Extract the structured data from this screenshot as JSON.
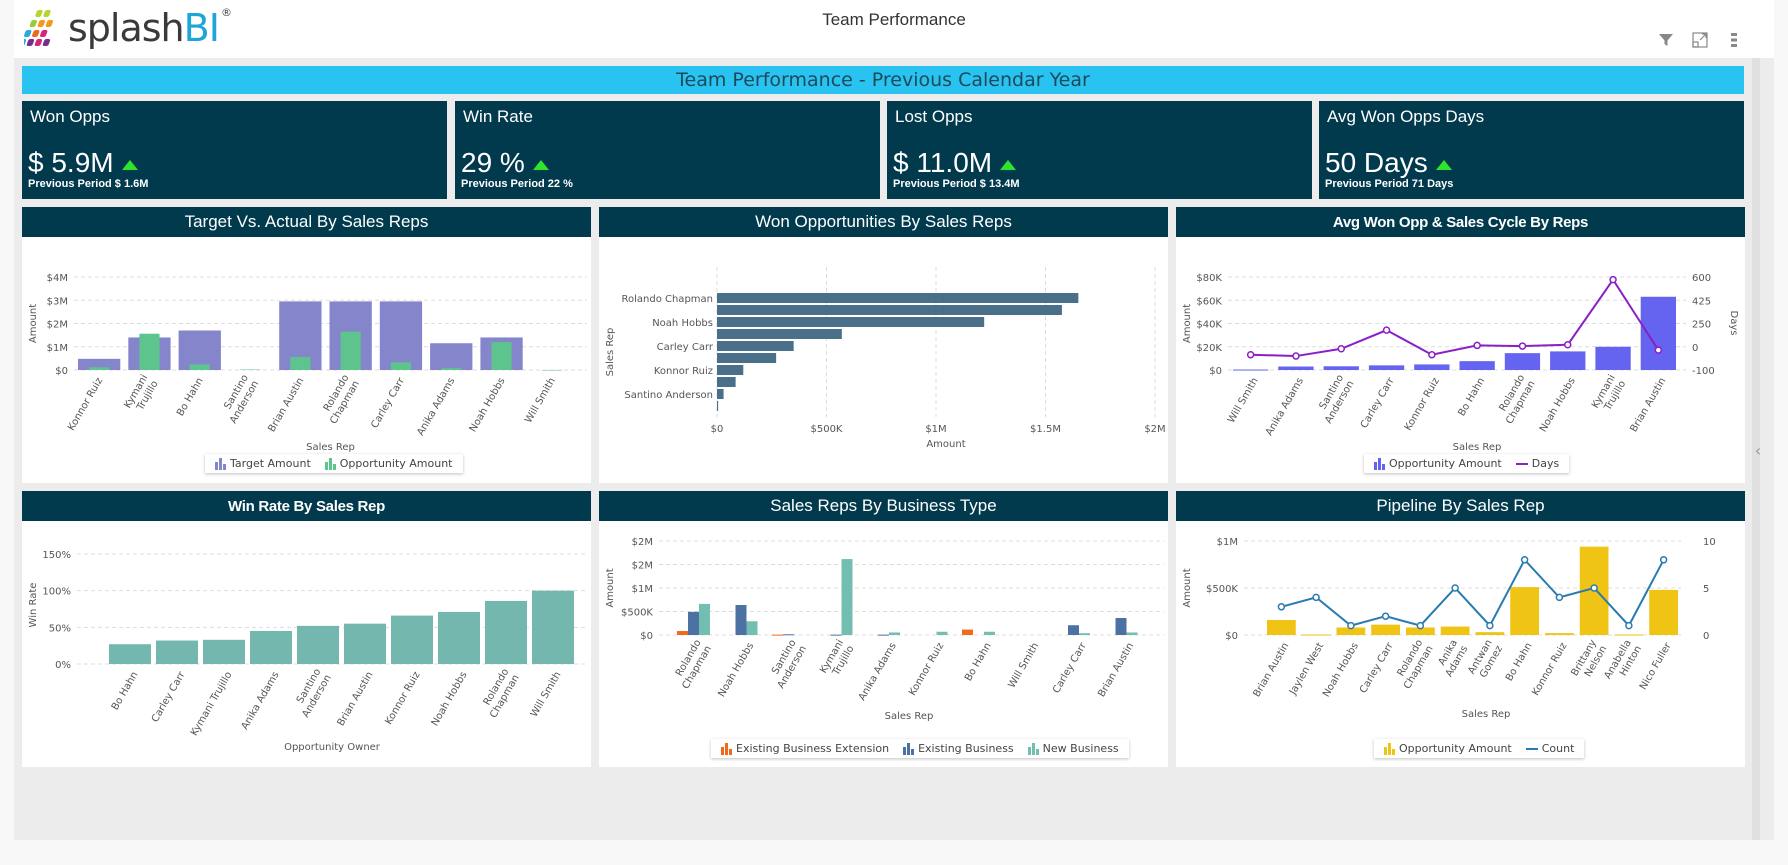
{
  "app": {
    "logo_text_main": "splash",
    "logo_text_accent": "BI",
    "logo_reg": "®",
    "page_title": "Team Performance",
    "icons": [
      "filter-icon",
      "expand-icon",
      "more-vertical-icon"
    ],
    "banner": "Team Performance - Previous Calendar Year",
    "collapse_glyph": "‹"
  },
  "kpis": [
    {
      "label": "Won Opps",
      "value": "$ 5.9M",
      "previous": "Previous Period $ 1.6M",
      "trend": "up"
    },
    {
      "label": "Win Rate",
      "value": "29 %",
      "previous": "Previous Period 22 %",
      "trend": "up"
    },
    {
      "label": "Lost Opps",
      "value": "$ 11.0M",
      "previous": "Previous Period $ 13.4M",
      "trend": "up"
    },
    {
      "label": "Avg Won Opps Days",
      "value": "50 Days",
      "previous": "Previous Period 71 Days",
      "trend": "up"
    }
  ],
  "colors": {
    "target": "#8585cc",
    "opp_green": "#5cc48c",
    "won_bar": "#4a6f88",
    "avg_bar": "#6464f0",
    "days_line": "#8a1fc6",
    "winrate": "#74b7ae",
    "ext": "#f06a1c",
    "existing": "#4c72a4",
    "newbiz": "#72bfb2",
    "pipeline_bar": "#f0c414",
    "count_line": "#2a7bb0"
  },
  "chart_data": [
    {
      "id": "target-vs-actual",
      "title": "Target Vs. Actual By Sales Reps",
      "type": "bar",
      "xlabel": "Sales Rep",
      "ylabel": "Amount",
      "ylim": [
        0,
        4000000
      ],
      "yticks": [
        "$0",
        "$1M",
        "$2M",
        "$3M",
        "$4M"
      ],
      "categories": [
        "Konnor Ruiz",
        "Kymani Trujillo",
        "Bo Hahn",
        "Santino Anderson",
        "Brian Austin",
        "Rolando Chapman",
        "Carley Carr",
        "Anika Adams",
        "Noah Hobbs",
        "Will Smith"
      ],
      "category_lines": [
        [
          "Konnor Ruiz"
        ],
        [
          "Kymani",
          "Trujillo"
        ],
        [
          "Bo Hahn"
        ],
        [
          "Santino",
          "Anderson"
        ],
        [
          "Brian Austin"
        ],
        [
          "Rolando",
          "Chapman"
        ],
        [
          "Carley Carr"
        ],
        [
          "Anika Adams"
        ],
        [
          "Noah Hobbs"
        ],
        [
          "Will Smith"
        ]
      ],
      "series": [
        {
          "name": "Target Amount",
          "values": [
            480000,
            1400000,
            1700000,
            0,
            2950000,
            2950000,
            2950000,
            1150000,
            1400000,
            0
          ]
        },
        {
          "name": "Opportunity Amount",
          "values": [
            120000,
            1560000,
            240000,
            20000,
            560000,
            1650000,
            330000,
            80000,
            1200000,
            0
          ]
        }
      ],
      "legend": [
        "Target Amount",
        "Opportunity Amount"
      ],
      "legend_position": "bottom"
    },
    {
      "id": "won-opps",
      "title": "Won Opportunities By Sales Reps",
      "type": "bar",
      "orientation": "horizontal",
      "xlabel": "Amount",
      "ylabel": "Sales Rep",
      "xlim": [
        0,
        2000000
      ],
      "xticks": [
        "$0",
        "$500K",
        "$1M",
        "$1.5M",
        "$2M"
      ],
      "categories": [
        "Rolando Chapman",
        "",
        "Noah Hobbs",
        "",
        "Carley Carr",
        "",
        "Konnor Ruiz",
        "",
        "Santino Anderson",
        ""
      ],
      "values": [
        1650000,
        1575000,
        1220000,
        570000,
        350000,
        270000,
        120000,
        85000,
        30000,
        5000
      ]
    },
    {
      "id": "avg-won-opp",
      "title": "Avg Won Opp & Sales Cycle By Reps",
      "type": "bar",
      "xlabel": "Sales Rep",
      "ylabel": "Amount",
      "y2label": "Days",
      "ylim": [
        0,
        80000
      ],
      "yticks": [
        "$0",
        "$20K",
        "$40K",
        "$60K",
        "$80K"
      ],
      "y2lim": [
        -100,
        600
      ],
      "y2ticks": [
        "-100",
        "0",
        "250",
        "425",
        "600"
      ],
      "categories": [
        "Will Smith",
        "Anika Adams",
        "Santino Anderson",
        "Carley Carr",
        "Konnor Ruiz",
        "Bo Hahn",
        "Rolando Chapman",
        "Noah Hobbs",
        "Kymani Trujillo",
        "Brian Austin"
      ],
      "category_lines": [
        [
          "Will Smith"
        ],
        [
          "Anika Adams"
        ],
        [
          "Santino",
          "Anderson"
        ],
        [
          "Carley Carr"
        ],
        [
          "Konnor Ruiz"
        ],
        [
          "Bo Hahn"
        ],
        [
          "Rolando",
          "Chapman"
        ],
        [
          "Noah Hobbs"
        ],
        [
          "Kymani",
          "Trujillo"
        ],
        [
          "Brian Austin"
        ]
      ],
      "series": [
        {
          "name": "Opportunity Amount",
          "type": "bar",
          "values": [
            400,
            3000,
            3200,
            4000,
            4800,
            7600,
            14500,
            16000,
            20000,
            63000
          ]
        },
        {
          "name": "Days",
          "type": "line",
          "axis": "right",
          "values": [
            15,
            5,
            60,
            200,
            15,
            85,
            80,
            90,
            580,
            50
          ]
        }
      ],
      "legend": [
        "Opportunity Amount",
        "Days"
      ],
      "legend_position": "bottom"
    },
    {
      "id": "win-rate",
      "title": "Win Rate By Sales Rep",
      "type": "bar",
      "xlabel": "Opportunity Owner",
      "ylabel": "Win Rate",
      "ylim": [
        0,
        150
      ],
      "yticks": [
        "0%",
        "50%",
        "100%",
        "150%"
      ],
      "categories": [
        "Bo Hahn",
        "Carley Carr",
        "Kymani Trujillo",
        "Anika Adams",
        "Santino Anderson",
        "Brian Austin",
        "Konnor Ruiz",
        "Noah Hobbs",
        "Rolando Chapman",
        "Will Smith"
      ],
      "category_lines": [
        [
          "Bo Hahn"
        ],
        [
          "Carley Carr"
        ],
        [
          "Kymani Trujillo"
        ],
        [
          "Anika Adams"
        ],
        [
          "Santino",
          "Anderson"
        ],
        [
          "Brian Austin"
        ],
        [
          "Konnor Ruiz"
        ],
        [
          "Noah Hobbs"
        ],
        [
          "Rolando",
          "Chapman"
        ],
        [
          "Will Smith"
        ]
      ],
      "values": [
        27,
        32,
        33,
        45,
        52,
        55,
        66,
        71,
        86,
        100
      ]
    },
    {
      "id": "business-type",
      "title": "Sales Reps By Business Type",
      "type": "bar",
      "xlabel": "Sales Rep",
      "ylabel": "Amount",
      "ylim": [
        0,
        2000000
      ],
      "yticks": [
        "$0",
        "$500K",
        "$1M",
        "$2M",
        "$2M"
      ],
      "categories": [
        "Rolando Chapman",
        "Noah Hobbs",
        "Santino Anderson",
        "Kymani Trujillo",
        "Anika Adams",
        "Konnor Ruiz",
        "Bo Hahn",
        "Will Smith",
        "Carley Carr",
        "Brian Austin"
      ],
      "category_lines": [
        [
          "Rolando",
          "Chapman"
        ],
        [
          "Noah Hobbs"
        ],
        [
          "Santino",
          "Anderson"
        ],
        [
          "Kymani",
          "Trujillo"
        ],
        [
          "Anika Adams"
        ],
        [
          "Konnor Ruiz"
        ],
        [
          "Bo Hahn"
        ],
        [
          "Will Smith"
        ],
        [
          "Carley Carr"
        ],
        [
          "Brian Austin"
        ]
      ],
      "series": [
        {
          "name": "Existing Business Extension",
          "values": [
            110000,
            0,
            10000,
            0,
            0,
            0,
            150000,
            0,
            0,
            0
          ]
        },
        {
          "name": "Existing Business",
          "values": [
            640000,
            830000,
            20000,
            10000,
            10000,
            0,
            0,
            0,
            270000,
            470000
          ]
        },
        {
          "name": "New Business",
          "values": [
            860000,
            380000,
            0,
            2100000,
            70000,
            90000,
            90000,
            0,
            50000,
            70000
          ]
        }
      ],
      "legend": [
        "Existing Business Extension",
        "Existing Business",
        "New Business"
      ],
      "legend_position": "bottom"
    },
    {
      "id": "pipeline",
      "title": "Pipeline By Sales Rep",
      "type": "bar",
      "xlabel": "Sales Rep",
      "ylabel": "Amount",
      "ylim": [
        0,
        1000000
      ],
      "yticks": [
        "$0",
        "$500K",
        "$1M"
      ],
      "y2lim": [
        0,
        10
      ],
      "y2ticks": [
        "0",
        "5",
        "10"
      ],
      "categories": [
        "Brian Austin",
        "Jaylen West",
        "Noah Hobbs",
        "Carley Carr",
        "Rolando Chapman",
        "Anika Adams",
        "Antwan Gomez",
        "Bo Hahn",
        "Konnor Ruiz",
        "Brittany Nelson",
        "Anabella Hinton",
        "Nico Fuller"
      ],
      "category_lines": [
        [
          "Brian Austin"
        ],
        [
          "Jaylen West"
        ],
        [
          "Noah Hobbs"
        ],
        [
          "Carley Carr"
        ],
        [
          "Rolando",
          "Chapman"
        ],
        [
          "Anika",
          "Adams"
        ],
        [
          "Antwan",
          "Gomez"
        ],
        [
          "Bo Hahn"
        ],
        [
          "Konnor Ruiz"
        ],
        [
          "Brittany",
          "Nelson"
        ],
        [
          "Anabella",
          "Hinton"
        ],
        [
          "Nico Fuller"
        ]
      ],
      "series": [
        {
          "name": "Opportunity Amount",
          "type": "bar",
          "values": [
            160000,
            5000,
            80000,
            110000,
            80000,
            90000,
            30000,
            510000,
            20000,
            940000,
            5000,
            480000
          ]
        },
        {
          "name": "Count",
          "type": "line",
          "axis": "right",
          "values": [
            3,
            4,
            1,
            2,
            1,
            5,
            1,
            8,
            4,
            5,
            1,
            8
          ]
        }
      ],
      "legend": [
        "Opportunity Amount",
        "Count"
      ],
      "legend_position": "bottom"
    }
  ]
}
